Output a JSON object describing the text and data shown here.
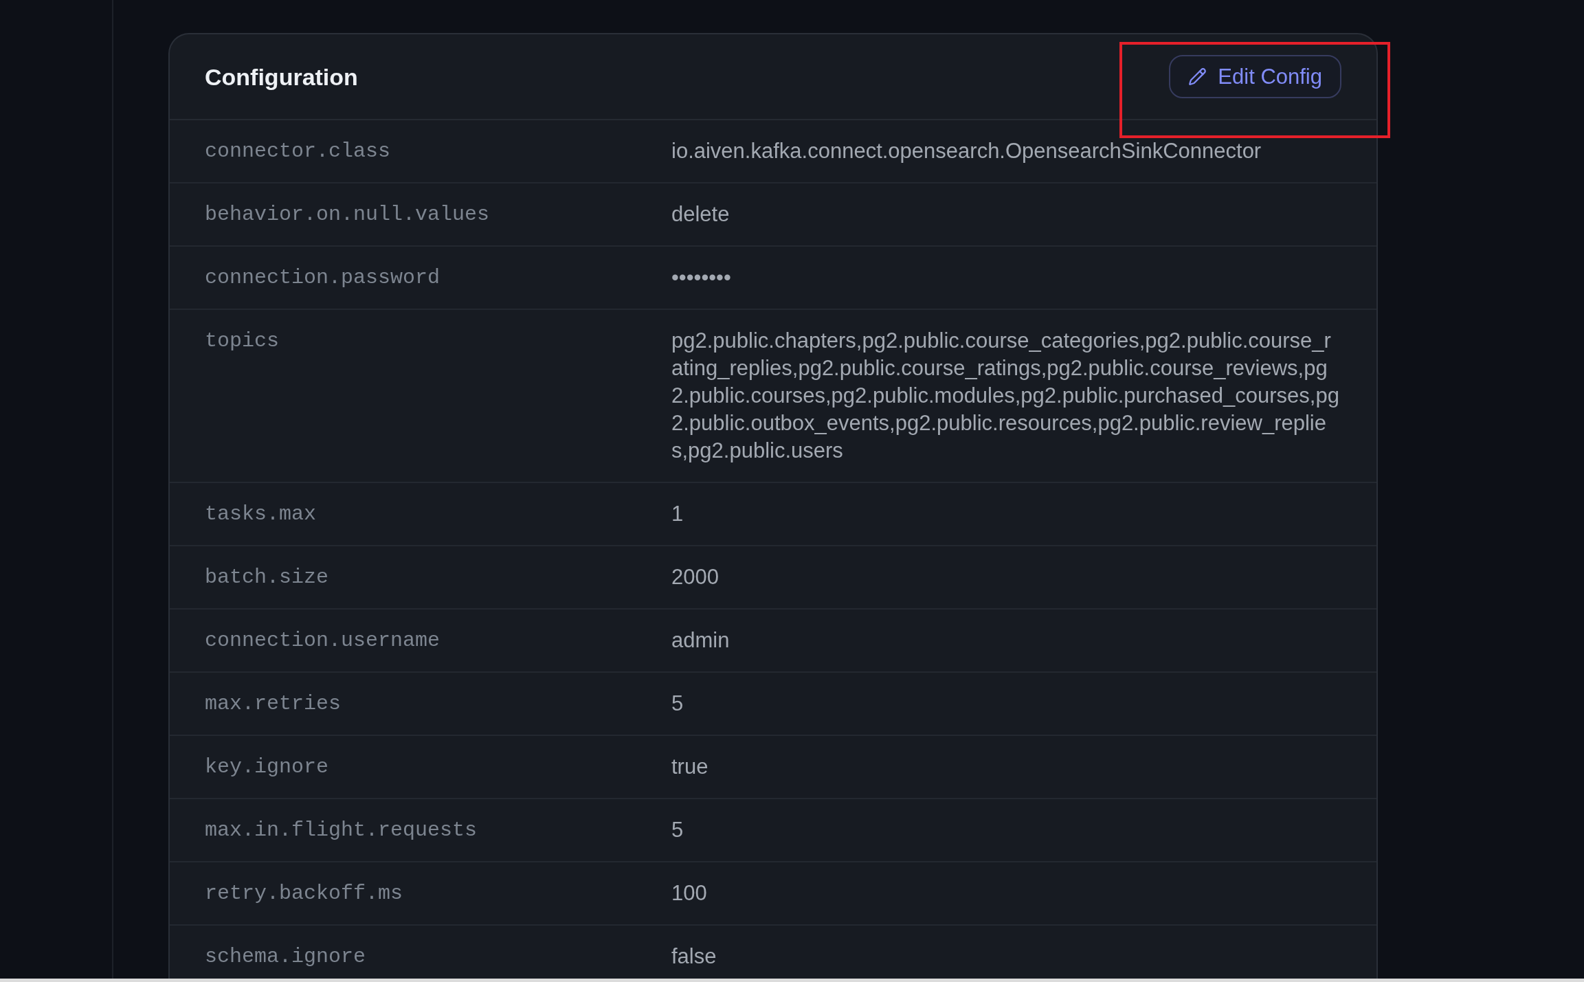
{
  "card": {
    "title": "Configuration",
    "edit_button": {
      "label": "Edit Config"
    },
    "rows": [
      {
        "key": "connector.class",
        "value": "io.aiven.kafka.connect.opensearch.OpensearchSinkConnector"
      },
      {
        "key": "behavior.on.null.values",
        "value": "delete"
      },
      {
        "key": "connection.password",
        "value": "••••••••"
      },
      {
        "key": "topics",
        "value": "pg2.public.chapters,pg2.public.course_categories,pg2.public.course_rating_replies,pg2.public.course_ratings,pg2.public.course_reviews,pg2.public.courses,pg2.public.modules,pg2.public.purchased_courses,pg2.public.outbox_events,pg2.public.resources,pg2.public.review_replies,pg2.public.users"
      },
      {
        "key": "tasks.max",
        "value": "1"
      },
      {
        "key": "batch.size",
        "value": "2000"
      },
      {
        "key": "connection.username",
        "value": "admin"
      },
      {
        "key": "max.retries",
        "value": "5"
      },
      {
        "key": "key.ignore",
        "value": "true"
      },
      {
        "key": "max.in.flight.requests",
        "value": "5"
      },
      {
        "key": "retry.backoff.ms",
        "value": "100"
      },
      {
        "key": "schema.ignore",
        "value": "false"
      }
    ]
  }
}
